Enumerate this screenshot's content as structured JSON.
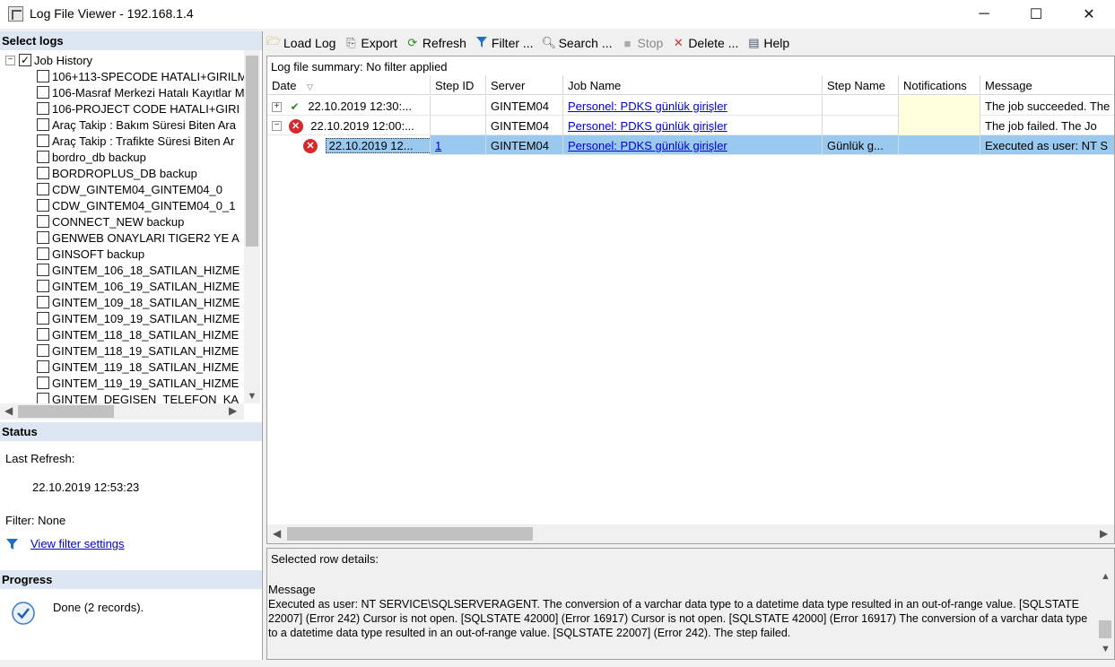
{
  "window": {
    "title": "Log File Viewer - 192.168.1.4",
    "minimize": "─",
    "maximize": "☐",
    "close": "✕"
  },
  "left": {
    "select_logs_header": "Select logs",
    "root": {
      "label": "Job History",
      "checked": "✓",
      "expander": "−"
    },
    "items": [
      "106+113-SPECODE HATALI+GIRILM",
      "106-Masraf Merkezi Hatalı Kayıtlar M",
      "106-PROJECT CODE HATALI+GIRI",
      "Araç Takip : Bakım Süresi Biten Ara",
      "Araç Takip : Trafikte Süresi Biten Ar",
      "bordro_db backup",
      "BORDROPLUS_DB backup",
      "CDW_GINTEM04_GINTEM04_0",
      "CDW_GINTEM04_GINTEM04_0_1",
      "CONNECT_NEW backup",
      "GENWEB ONAYLARI TIGER2 YE A",
      "GINSOFT backup",
      "GINTEM_106_18_SATILAN_HIZME",
      "GINTEM_106_19_SATILAN_HIZME",
      "GINTEM_109_18_SATILAN_HIZME",
      "GINTEM_109_19_SATILAN_HIZME",
      "GINTEM_118_18_SATILAN_HIZME",
      "GINTEM_118_19_SATILAN_HIZME",
      "GINTEM_119_18_SATILAN_HIZME",
      "GINTEM_119_19_SATILAN_HIZME",
      "GINTEM_DEGISEN_TELEFON_KA"
    ],
    "status_header": "Status",
    "last_refresh_label": "Last Refresh:",
    "last_refresh_value": "22.10.2019 12:53:23",
    "filter_label": "Filter: None",
    "view_filter_link": "View filter settings",
    "progress_header": "Progress",
    "progress_text": "Done (2 records)."
  },
  "toolbar": {
    "load_log": "Load Log",
    "export": "Export",
    "refresh": "Refresh",
    "filter": "Filter ...",
    "search": "Search ...",
    "stop": "Stop",
    "delete": "Delete ...",
    "help": "Help"
  },
  "grid": {
    "summary": "Log file summary: No filter applied",
    "columns": [
      "Date",
      "Step ID",
      "Server",
      "Job Name",
      "Step Name",
      "Notifications",
      "Message"
    ],
    "sort_glyph": "▽",
    "rows": [
      {
        "expander": "+",
        "status_icon": "✔",
        "date": "22.10.2019 12:30:...",
        "step_id": "",
        "server": "GINTEM04",
        "job_name": "Personel: PDKS günlük girişler",
        "step_name": "",
        "notifications": "",
        "message": "The job succeeded.  The"
      },
      {
        "expander": "−",
        "status_icon": "✕",
        "date": "22.10.2019 12:00:...",
        "step_id": "",
        "server": "GINTEM04",
        "job_name": "Personel: PDKS günlük girişler",
        "step_name": "",
        "notifications": "",
        "message": "The job failed.  The Jo"
      },
      {
        "expander": "",
        "status_icon": "✕",
        "date": "22.10.2019 12...",
        "step_id": "1",
        "server": "GINTEM04",
        "job_name": "Personel: PDKS günlük girişler",
        "step_name": "Günlük g...",
        "notifications": "",
        "message": "Executed as user: NT S"
      }
    ]
  },
  "details": {
    "label": "Selected row details:",
    "message_header": "Message",
    "message_text": "Executed as user: NT SERVICE\\SQLSERVERAGENT. The conversion of a varchar data type to a datetime data type resulted in an out-of-range value. [SQLSTATE 22007] (Error 242)  Cursor is not open. [SQLSTATE 42000] (Error 16917)  Cursor is not open. [SQLSTATE 42000] (Error 16917)  The conversion of a varchar data type to a datetime data type resulted in an out-of-range value. [SQLSTATE 22007] (Error 242).  The step failed."
  }
}
